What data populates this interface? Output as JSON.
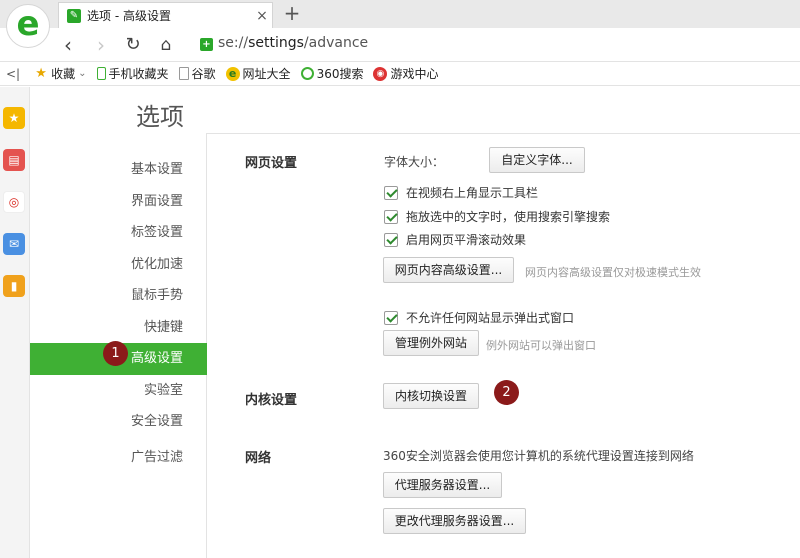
{
  "browser": {
    "logo_glyph": "e",
    "tab": {
      "favicon": "wrench-icon",
      "title": "选项 - 高级设置",
      "close": "×"
    },
    "new_tab": "+",
    "address": {
      "scheme": "se://",
      "host": "settings",
      "path": "/advance"
    }
  },
  "bookmarks": {
    "collapse": "<|",
    "items": [
      {
        "label": "收藏",
        "icon": "star-icon",
        "dropdown": "⌄"
      },
      {
        "label": "手机收藏夹",
        "icon": "phone-icon"
      },
      {
        "label": "谷歌",
        "icon": "page-icon"
      },
      {
        "label": "网址大全",
        "icon": "globe-icon"
      },
      {
        "label": "360搜索",
        "icon": "search360-icon"
      },
      {
        "label": "游戏中心",
        "icon": "game-icon"
      }
    ]
  },
  "page": {
    "title": "选项",
    "nav": [
      {
        "label": "基本设置"
      },
      {
        "label": "界面设置"
      },
      {
        "label": "标签设置"
      },
      {
        "label": "优化加速"
      },
      {
        "label": "鼠标手势"
      },
      {
        "label": "快捷键"
      },
      {
        "label": "高级设置",
        "active": true
      },
      {
        "label": "实验室"
      },
      {
        "label": "安全设置"
      },
      {
        "label": "广告过滤"
      }
    ],
    "markers": {
      "one": "1",
      "two": "2"
    },
    "web": {
      "label": "网页设置",
      "font_size_label": "字体大小：",
      "custom_font_button": "自定义字体...",
      "checks": [
        "在视频右上角显示工具栏",
        "拖放选中的文字时，使用搜索引擎搜索",
        "启用网页平滑滚动效果"
      ],
      "advanced_button": "网页内容高级设置...",
      "advanced_hint": "网页内容高级设置仅对极速模式生效",
      "popup_check": "不允许任何网站显示弹出式窗口",
      "exceptions_button": "管理例外网站",
      "exceptions_hint": "例外网站可以弹出窗口"
    },
    "kernel": {
      "label": "内核设置",
      "button": "内核切换设置"
    },
    "network": {
      "label": "网络",
      "description": "360安全浏览器会使用您计算机的系统代理设置连接到网络",
      "proxy_button": "代理服务器设置...",
      "change_proxy_button": "更改代理服务器设置..."
    }
  },
  "colors": {
    "accent": "#3fb034",
    "marker": "#8b1a1a"
  }
}
